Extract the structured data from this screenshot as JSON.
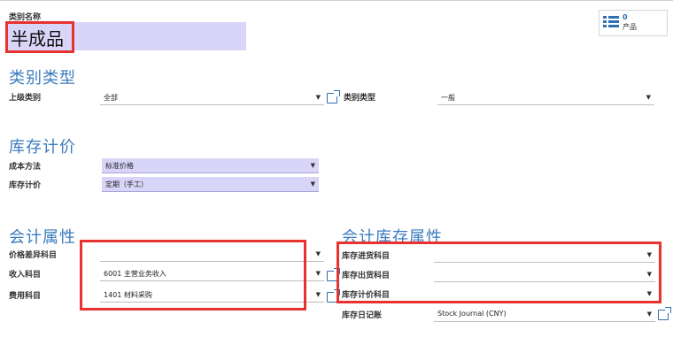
{
  "category": {
    "name_label": "类别名称",
    "name_value": "半成品"
  },
  "stat_button": {
    "count": "0",
    "label": "产品",
    "icon": "list-icon"
  },
  "sections": {
    "category_type": "类别类型",
    "inventory_valuation": "库存计价",
    "accounting": "会计属性",
    "accounting_inventory": "会计库存属性"
  },
  "category_type": {
    "parent_label": "上级类别",
    "parent_value": "全部",
    "type_label": "类别类型",
    "type_value": "一般"
  },
  "valuation": {
    "cost_method_label": "成本方法",
    "cost_method_value": "标准价格",
    "inventory_valuation_label": "库存计价",
    "inventory_valuation_value": "定期（手工）"
  },
  "accounting": {
    "price_diff_label": "价格差异科目",
    "price_diff_value": "",
    "income_label": "收入科目",
    "income_value": "6001 主营业务收入",
    "expense_label": "费用科目",
    "expense_value": "1401 材料采购"
  },
  "accounting_inventory": {
    "stock_in_label": "库存进货科目",
    "stock_in_value": "",
    "stock_out_label": "库存出货科目",
    "stock_out_value": "",
    "stock_valuation_label": "库存计价科目",
    "stock_valuation_value": "",
    "stock_journal_label": "库存日记账",
    "stock_journal_value": "Stock Journal (CNY)"
  },
  "colors": {
    "highlight_red": "#e8322f",
    "section_blue": "#3b7bbf",
    "required_bg": "#d8d5f8"
  }
}
